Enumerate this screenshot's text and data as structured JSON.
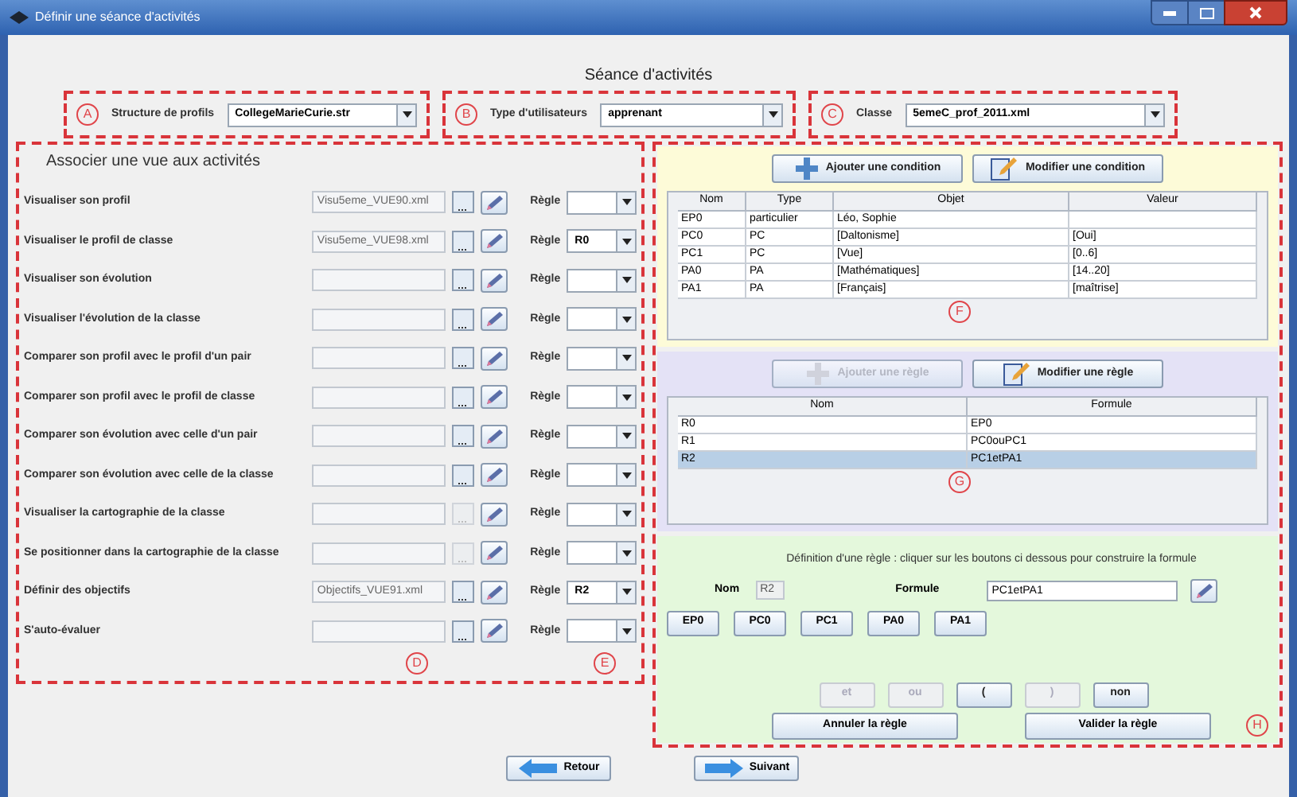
{
  "window": {
    "title": "Définir une séance d'activités"
  },
  "heading": "Séance d'activités",
  "selectors": [
    {
      "marker": "A",
      "label": "Structure de profils",
      "value": "CollegeMarieCurie.str"
    },
    {
      "marker": "B",
      "label": "Type d'utilisateurs",
      "value": "apprenant"
    },
    {
      "marker": "C",
      "label": "Classe",
      "value": "5emeC_prof_2011.xml"
    }
  ],
  "views": {
    "title": "Associer une vue aux activités",
    "markers": [
      "D",
      "E"
    ],
    "rows": [
      {
        "label": "Visualiser son profil",
        "file": "Visu5eme_VUE90.xml",
        "browse_disabled": false,
        "rule_label": "Règle"
      },
      {
        "label": "Visualiser le profil de classe",
        "file": "Visu5eme_VUE98.xml",
        "browse_disabled": false,
        "rule_label": "Règle",
        "rule": "R0"
      },
      {
        "label": "Visualiser son évolution",
        "browse_disabled": false,
        "rule_label": "Règle"
      },
      {
        "label": "Visualiser l'évolution de la classe",
        "browse_disabled": false,
        "rule_label": "Règle"
      },
      {
        "label": "Comparer son profil avec le profil d'un pair",
        "browse_disabled": false,
        "rule_label": "Règle"
      },
      {
        "label": "Comparer son profil avec le profil de classe",
        "browse_disabled": false,
        "rule_label": "Règle"
      },
      {
        "label": "Comparer son évolution avec celle d'un pair",
        "browse_disabled": false,
        "rule_label": "Règle"
      },
      {
        "label": "Comparer son évolution avec celle de la classe",
        "browse_disabled": false,
        "rule_label": "Règle"
      },
      {
        "label": "Visualiser la cartographie de la classe",
        "browse_disabled": true,
        "rule_label": "Règle"
      },
      {
        "label": "Se positionner dans la cartographie de la classe",
        "browse_disabled": true,
        "rule_label": "Règle"
      },
      {
        "label": "Définir des objectifs",
        "file": "Objectifs_VUE91.xml",
        "browse_disabled": false,
        "rule_label": "Règle",
        "rule": "R2"
      },
      {
        "label": "S'auto-évaluer",
        "browse_disabled": false,
        "rule_label": "Règle"
      }
    ]
  },
  "conditions": {
    "marker": "F",
    "buttons": [
      {
        "kind": "add",
        "label": "Ajouter une condition",
        "disabled": false
      },
      {
        "kind": "edit",
        "label": "Modifier une condition",
        "disabled": false
      }
    ],
    "columns": [
      "Nom",
      "Type",
      "Objet",
      "Valeur"
    ],
    "rows": [
      {
        "cells": [
          "EP0",
          "particulier",
          "Léo, Sophie"
        ]
      },
      {
        "cells": [
          "PC0",
          "PC",
          "[Daltonisme]",
          "[Oui]"
        ]
      },
      {
        "cells": [
          "PC1",
          "PC",
          "[Vue]",
          "[0..6]"
        ]
      },
      {
        "cells": [
          "PA0",
          "PA",
          "[Mathématiques]",
          "[14..20]"
        ]
      },
      {
        "cells": [
          "PA1",
          "PA",
          "[Français]",
          "[maîtrise]"
        ]
      }
    ]
  },
  "rules": {
    "marker": "G",
    "buttons": [
      {
        "kind": "add",
        "label": "Ajouter une règle",
        "disabled": true
      },
      {
        "kind": "edit",
        "label": "Modifier une règle",
        "disabled": false
      }
    ],
    "columns": [
      "Nom",
      "Formule"
    ],
    "rows": [
      {
        "cells": [
          "R0",
          "EP0"
        ],
        "selected": false
      },
      {
        "cells": [
          "R1",
          "PC0ouPC1"
        ],
        "selected": false
      },
      {
        "cells": [
          "R2",
          "PC1etPA1"
        ],
        "selected": true
      }
    ]
  },
  "definition": {
    "marker": "H",
    "instruction": "Définition d'une règle : cliquer sur les boutons ci dessous pour construire la formule",
    "name_label": "Nom",
    "name": "R2",
    "formula_label": "Formule",
    "formula": "PC1etPA1",
    "terms": [
      "EP0",
      "PC0",
      "PC1",
      "PA0",
      "PA1"
    ],
    "operators": [
      {
        "label": "et",
        "disabled": true
      },
      {
        "label": "ou",
        "disabled": true
      },
      {
        "label": "(",
        "disabled": false
      },
      {
        "label": ")",
        "disabled": true
      },
      {
        "label": "non",
        "disabled": false
      }
    ],
    "actions": [
      "Annuler la règle",
      "Valider la règle"
    ]
  },
  "nav": [
    {
      "kind": "back",
      "label": "Retour"
    },
    {
      "kind": "next",
      "label": "Suivant"
    }
  ]
}
